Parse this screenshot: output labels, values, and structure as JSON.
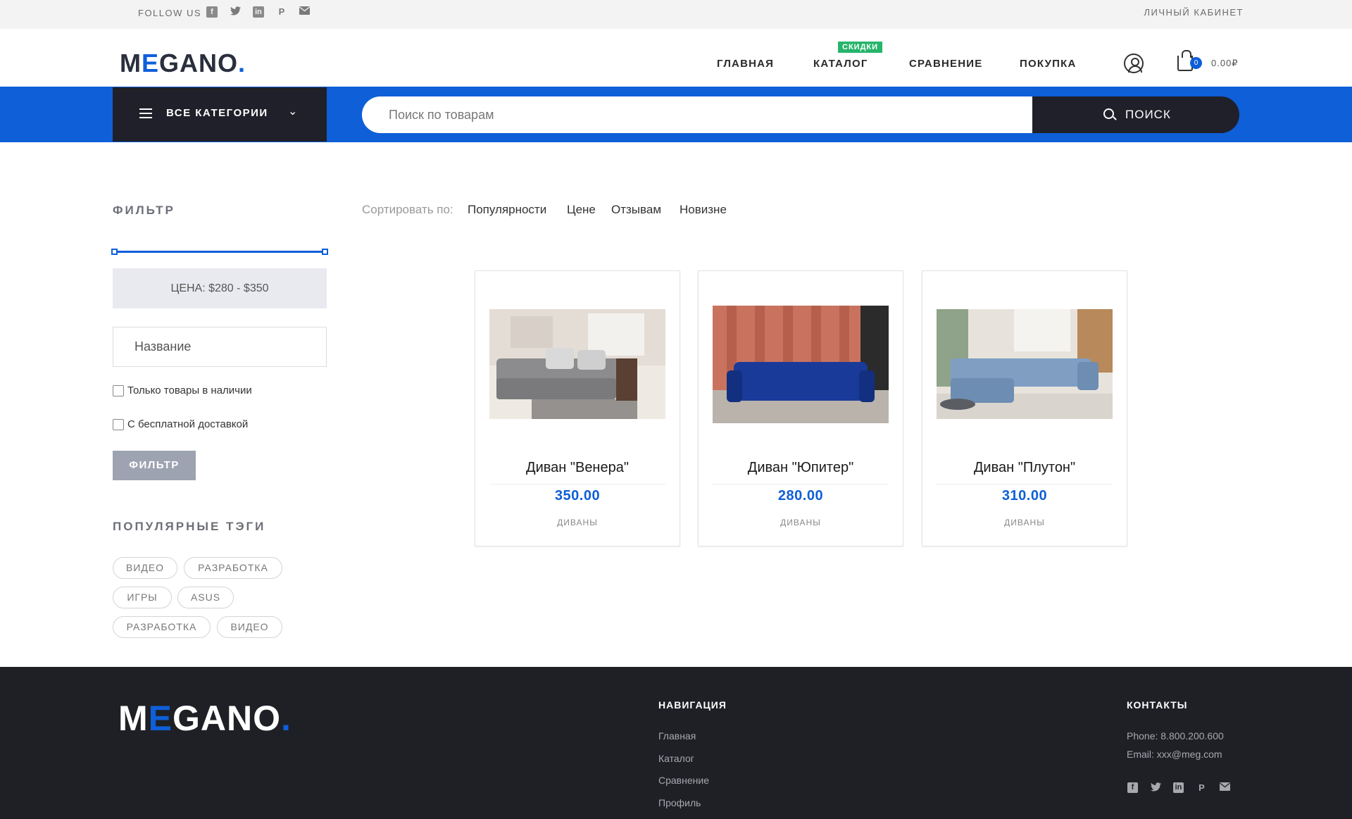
{
  "topbar": {
    "follow_label": "FOLLOW US",
    "social_icons": [
      "facebook-icon",
      "twitter-icon",
      "linkedin-icon",
      "pinterest-icon",
      "mail-icon"
    ],
    "account_label": "ЛИЧНЫЙ КАБИНЕТ"
  },
  "header": {
    "logo": {
      "pre": "M",
      "accent": "E",
      "post": "GANO",
      "dot": "."
    },
    "nav": [
      "ГЛАВНАЯ",
      "КАТАЛОГ",
      "СРАВНЕНИЕ",
      "ПОКУПКА"
    ],
    "catalog_badge": "СКИДКИ",
    "cart_count": "0",
    "cart_total": "0.00₽"
  },
  "search": {
    "categories_label": "ВСЕ КАТЕГОРИИ",
    "placeholder": "Поиск по товарам",
    "button_label": "ПОИСК"
  },
  "filter": {
    "heading": "ФИЛЬТР",
    "price_text": "ЦЕНА:   $280 - $350",
    "name_placeholder": "Название",
    "checkbox_in_stock": "Только товары в наличии",
    "checkbox_free_delivery": "С бесплатной доставкой",
    "button_label": "ФИЛЬТР"
  },
  "tags": {
    "heading": "ПОПУЛЯРНЫЕ ТЭГИ",
    "items": [
      "ВИДЕО",
      "РАЗРАБОТКА",
      "ИГРЫ",
      "ASUS",
      "РАЗРАБОТКА",
      "ВИДЕО"
    ]
  },
  "sort": {
    "label": "Сортировать по:",
    "options": [
      "Популярности",
      "Цене",
      "Отзывам",
      "Новизне"
    ]
  },
  "products": [
    {
      "title": "Диван \"Венера\"",
      "price": "350.00",
      "category": "ДИВАНЫ",
      "sofa_color": "#8c8c8e",
      "room_color": "#efe9e3"
    },
    {
      "title": "Диван \"Юпитер\"",
      "price": "280.00",
      "category": "ДИВАНЫ",
      "sofa_color": "#1a3a9a",
      "room_color": "#c9735f"
    },
    {
      "title": "Диван \"Плутон\"",
      "price": "310.00",
      "category": "ДИВАНЫ",
      "sofa_color": "#7f9ec2",
      "room_color": "#e7e3dc"
    }
  ],
  "footer": {
    "logo": {
      "pre": "M",
      "accent": "E",
      "post": "GANO",
      "dot": "."
    },
    "nav_heading": "НАВИГАЦИЯ",
    "nav_links": [
      "Главная",
      "Каталог",
      "Сравнение",
      "Профиль"
    ],
    "contacts_heading": "КОНТАКТЫ",
    "phone": "Phone: 8.800.200.600",
    "email": "Email: xxx@meg.com",
    "social_icons": [
      "facebook-icon",
      "twitter-icon",
      "linkedin-icon",
      "pinterest-icon",
      "mail-icon"
    ]
  },
  "colors": {
    "accent": "#0e5fd8",
    "dark": "#1f2029",
    "badge": "#27b46b"
  }
}
